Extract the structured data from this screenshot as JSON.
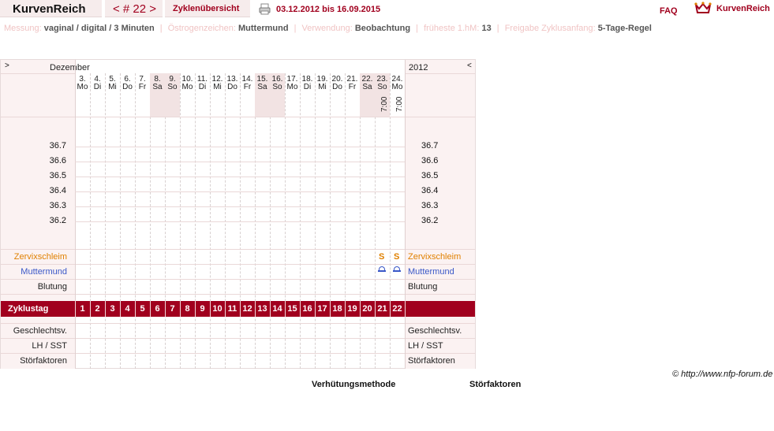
{
  "header": {
    "logo": "KurvenReich",
    "cycle_nav": "< # 22 >",
    "overview_link": "Zyklenübersicht",
    "date_range": "03.12.2012 bis 16.09.2015",
    "faq": "FAQ",
    "brand": "KurvenReich",
    "colors": {
      "accent": "#a1001e",
      "tab_bg": "#f6ecec"
    },
    "icons": [
      "printer-icon",
      "crown-heart-icon"
    ]
  },
  "settings": {
    "measurement_label": "Messung:",
    "measurement_value": "vaginal / digital / 3 Minuten",
    "estrogen_label": "Östrogenzeichen:",
    "estrogen_value": "Muttermund",
    "usage_label": "Verwendung:",
    "usage_value": "Beobachtung",
    "earliest_label": "früheste 1.hM:",
    "earliest_value": "13",
    "release_label": "Freigabe Zyklusanfang:",
    "release_value": "5-Tage-Regel"
  },
  "chart": {
    "month": "Dezember",
    "year": "2012",
    "prev_arrow": ">",
    "next_arrow": "<",
    "days": [
      {
        "num": "3.",
        "wd": "Mo"
      },
      {
        "num": "4.",
        "wd": "Di"
      },
      {
        "num": "5.",
        "wd": "Mi"
      },
      {
        "num": "6.",
        "wd": "Do"
      },
      {
        "num": "7.",
        "wd": "Fr"
      },
      {
        "num": "8.",
        "wd": "Sa"
      },
      {
        "num": "9.",
        "wd": "So"
      },
      {
        "num": "10.",
        "wd": "Mo"
      },
      {
        "num": "11.",
        "wd": "Di"
      },
      {
        "num": "12.",
        "wd": "Mi"
      },
      {
        "num": "13.",
        "wd": "Do"
      },
      {
        "num": "14.",
        "wd": "Fr"
      },
      {
        "num": "15.",
        "wd": "Sa"
      },
      {
        "num": "16.",
        "wd": "So"
      },
      {
        "num": "17.",
        "wd": "Mo"
      },
      {
        "num": "18.",
        "wd": "Di"
      },
      {
        "num": "19.",
        "wd": "Mi"
      },
      {
        "num": "20.",
        "wd": "Do"
      },
      {
        "num": "21.",
        "wd": "Fr"
      },
      {
        "num": "22.",
        "wd": "Sa"
      },
      {
        "num": "23.",
        "wd": "So"
      },
      {
        "num": "24.",
        "wd": "Mo"
      }
    ],
    "times": [
      "7:00",
      "7:00"
    ],
    "temperatures": [
      "36.7",
      "36.6",
      "36.5",
      "36.4",
      "36.3",
      "36.2"
    ],
    "rows": {
      "mucus": "Zervixschleim",
      "cervix": "Muttermund",
      "bleeding": "Blutung",
      "cycle_day": "Zyklustag",
      "intercourse": "Geschlechtsv.",
      "lh": "LH / SST",
      "disturbances": "Störfaktoren"
    },
    "mucus_marks": [
      "S",
      "S"
    ],
    "cycle_days": [
      "1",
      "2",
      "3",
      "4",
      "5",
      "6",
      "7",
      "8",
      "9",
      "10",
      "11",
      "12",
      "13",
      "14",
      "15",
      "16",
      "17",
      "18",
      "19",
      "20",
      "21",
      "22"
    ]
  },
  "footer": {
    "copyright": "© http://www.nfp-forum.de",
    "legend_method": "Verhütungsmethode",
    "legend_factors": "Störfaktoren"
  }
}
